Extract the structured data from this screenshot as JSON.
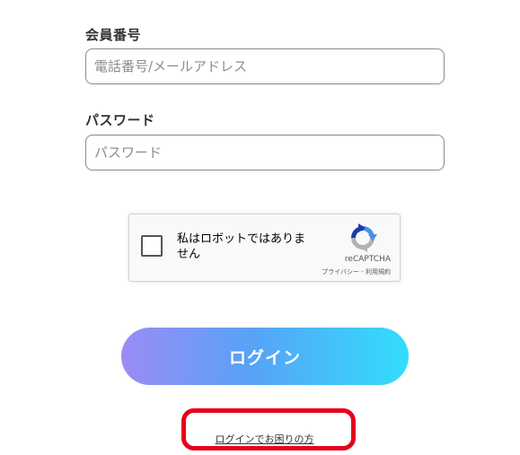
{
  "form": {
    "member_label": "会員番号",
    "member_placeholder": "電話番号/メールアドレス",
    "member_value": "",
    "password_label": "パスワード",
    "password_placeholder": "パスワード",
    "password_value": ""
  },
  "recaptcha": {
    "checkbox_text": "私はロボットではありません",
    "brand": "reCAPTCHA",
    "privacy_link": "プライバシー",
    "separator": " - ",
    "terms_link": "利用規約",
    "checked": false
  },
  "actions": {
    "login_label": "ログイン",
    "help_link": "ログインでお困りの方"
  },
  "colors": {
    "button_gradient_start": "#9a8cf6",
    "button_gradient_end": "#33ddfc",
    "highlight": "#e8001c"
  }
}
